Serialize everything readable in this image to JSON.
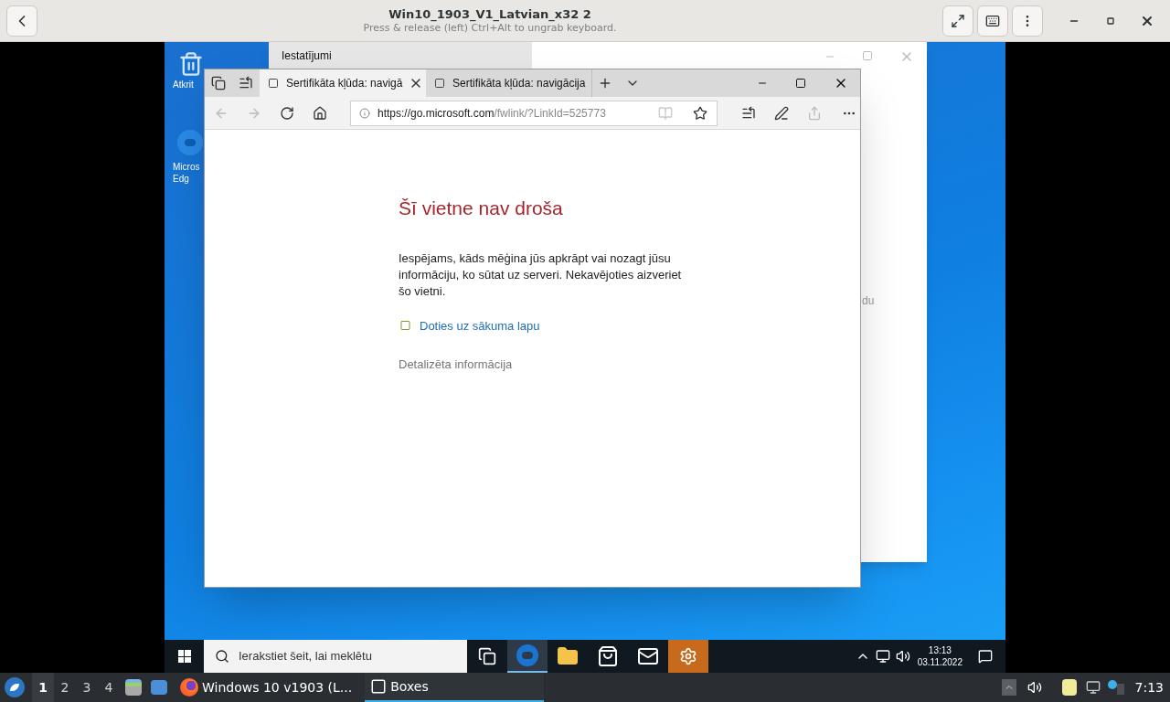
{
  "header": {
    "title": "Win10_1903_V1_Latvian_x32 2",
    "subtitle": "Press & release (left) Ctrl+Alt to ungrab keyboard."
  },
  "desktop_icons": [
    {
      "kind": "recycle",
      "lines": [
        "Atkrit"
      ]
    },
    {
      "kind": "edge",
      "lines": [
        "Micros",
        "Edg"
      ]
    }
  ],
  "background_window": {
    "title": "Iestatījumi",
    "text": "du"
  },
  "browser": {
    "tabs": [
      {
        "title": "Sertifikāta kļūda: navigā",
        "selected": true
      },
      {
        "title": "Sertifikāta kļūda: navigācija",
        "selected": false
      }
    ],
    "url_host": "https://go.microsoft.com",
    "url_path": "/fwlink/?LinkId=525773",
    "page": {
      "heading": "Šī vietne nav droša",
      "message": "Iespējams, kāds mēģina jūs apkrāpt vai nozagt jūsu informāciju, ko sūtat uz serveri. Nekavējoties aizveriet šo vietni.",
      "link": "Doties uz sākuma lapu",
      "details": "Detalizēta informācija"
    }
  },
  "win_taskbar": {
    "search_placeholder": "Ierakstiet šeit, lai meklētu",
    "apps": [
      {
        "kind": "taskview",
        "selected": false
      },
      {
        "kind": "edge",
        "selected": true
      },
      {
        "kind": "explorer",
        "selected": false
      },
      {
        "kind": "store",
        "selected": false
      },
      {
        "kind": "mail",
        "selected": false
      },
      {
        "kind": "settings",
        "selected": false
      }
    ],
    "time": "13:13",
    "date": "03.11.2022"
  },
  "linux_panel": {
    "workspaces": [
      {
        "label": "1",
        "selected": true
      },
      {
        "label": "2",
        "selected": false
      },
      {
        "label": "3",
        "selected": false
      },
      {
        "label": "4",
        "selected": false
      }
    ],
    "tasks": [
      {
        "kind": "firefox",
        "label": "Windows 10 v1903 (L...",
        "selected": false
      },
      {
        "kind": "boxes",
        "label": "Boxes",
        "selected": true
      }
    ],
    "clock": "7:13"
  }
}
